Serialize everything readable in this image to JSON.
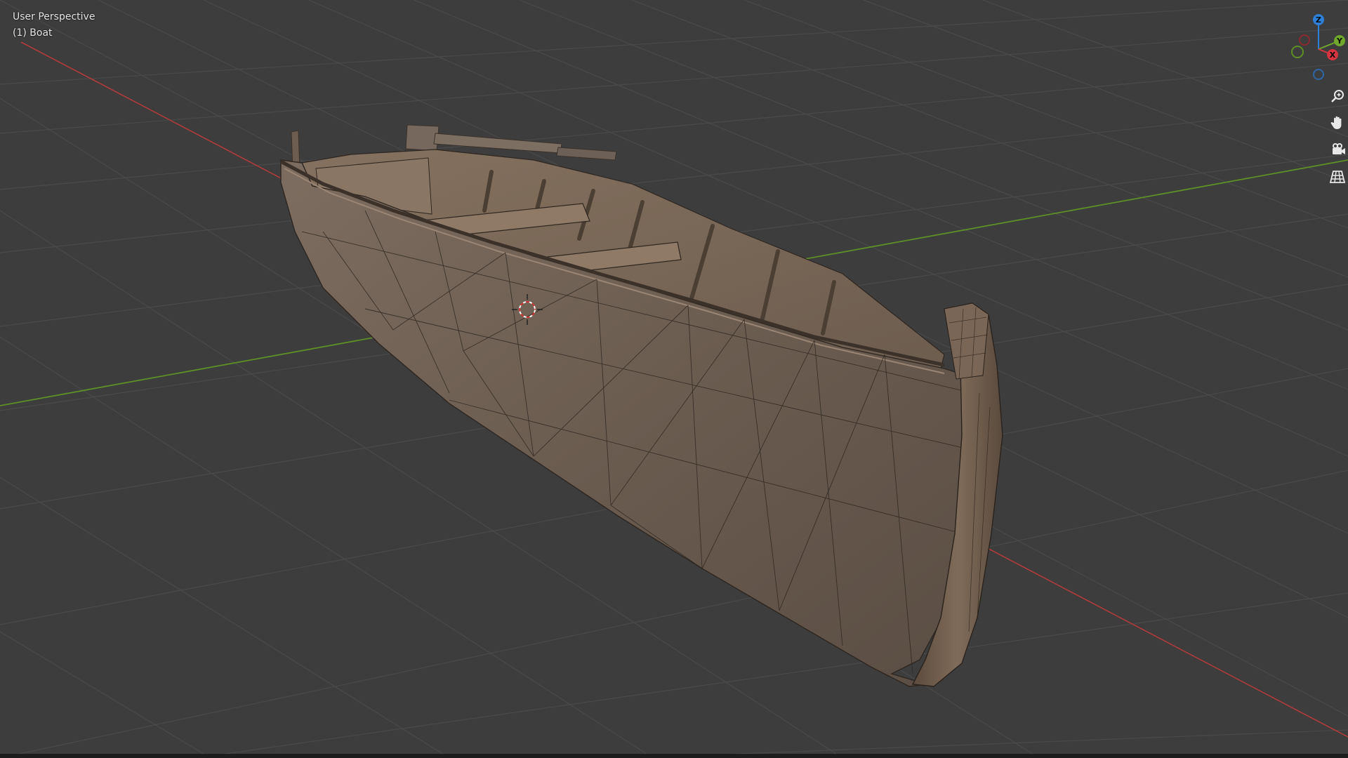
{
  "viewport": {
    "view_name": "User Perspective",
    "active_object": "(1) Boat",
    "background_color": "#3d3d3d",
    "grid_color": "#4a4a4a",
    "axis_x_color": "#c0393b",
    "axis_y_color": "#6a9a2a"
  },
  "gizmo": {
    "z_label": "Z",
    "y_label": "Y",
    "x_label": "X",
    "z_color": "#2e7fd8",
    "y_color": "#6fa82c",
    "x_color": "#d6343f"
  },
  "nav_buttons": [
    {
      "icon": "zoom-icon"
    },
    {
      "icon": "hand-pan-icon"
    },
    {
      "icon": "camera-icon"
    },
    {
      "icon": "grid-perspective-icon"
    }
  ],
  "cursor_3d": {
    "icon": "3d-cursor-icon"
  },
  "object": {
    "name": "Boat",
    "hull_color": "#6e5f52",
    "interior_color": "#8c7865"
  }
}
